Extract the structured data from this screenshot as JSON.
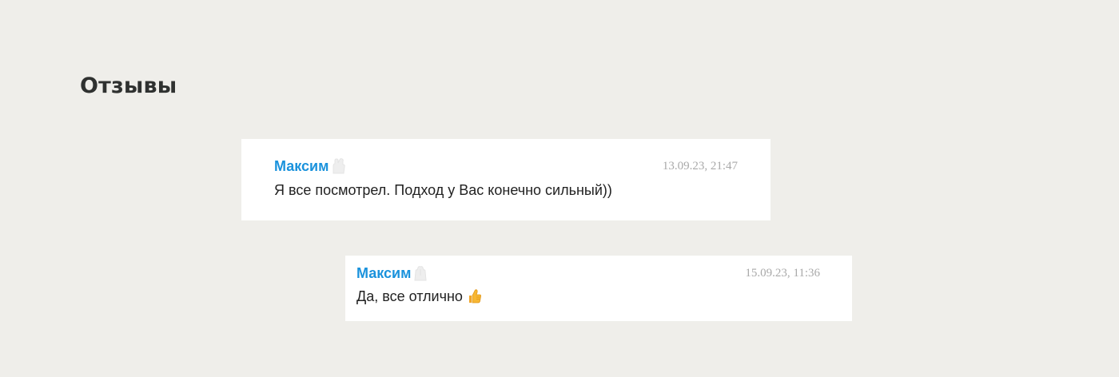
{
  "section": {
    "title": "Отзывы"
  },
  "reviews": [
    {
      "author": "Максим",
      "date": "13.09.23, 21:47",
      "text": "Я все посмотрел. Подход у Вас конечно сильный))"
    },
    {
      "author": "Максим",
      "date": "15.09.23, 11:36",
      "text": "Да, все отлично",
      "emoji": "thumbs-up-icon"
    }
  ],
  "colors": {
    "background": "#efeeea",
    "card": "#ffffff",
    "author": "#1a92dc",
    "date": "#a9a9a9",
    "text": "#222222",
    "title": "#2f3130"
  }
}
